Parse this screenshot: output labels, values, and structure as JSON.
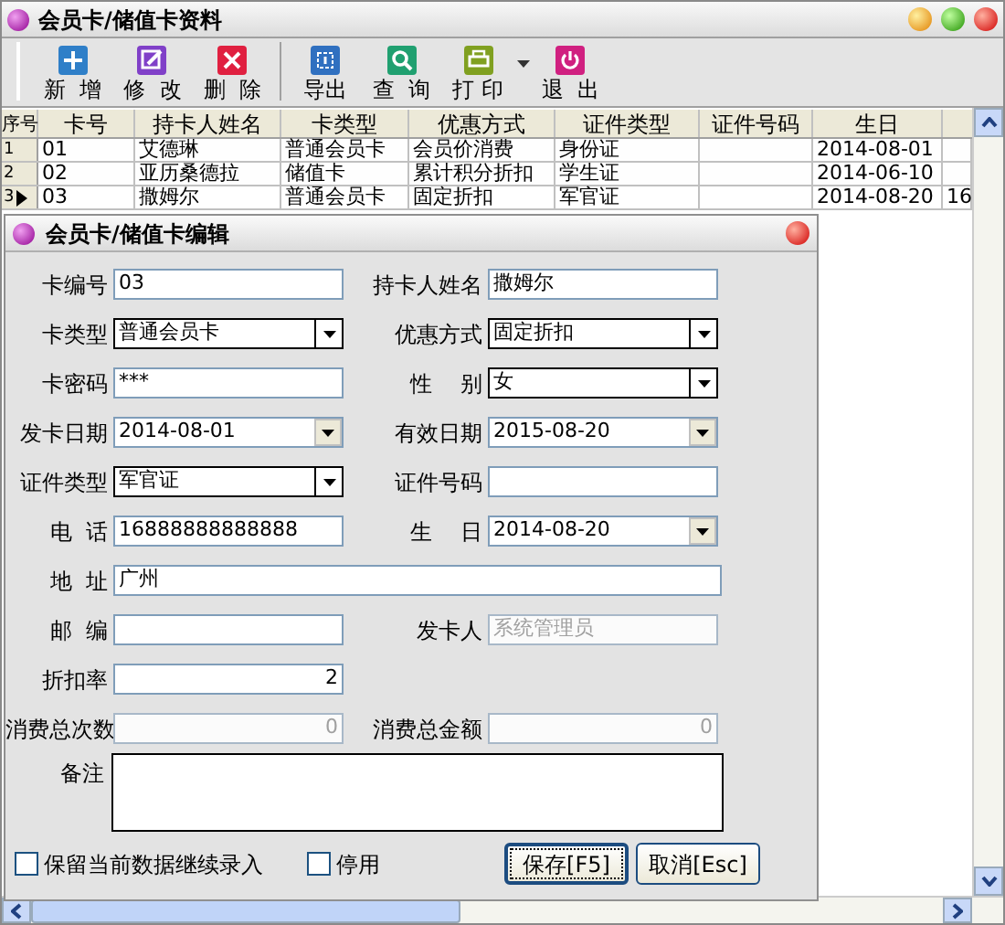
{
  "window": {
    "title": "会员卡/储值卡资料"
  },
  "toolbar": {
    "buttons": [
      {
        "kind": "add",
        "label": "新  增"
      },
      {
        "kind": "edit",
        "label": "修  改"
      },
      {
        "kind": "delete",
        "label": "删  除"
      },
      {
        "kind": "separator"
      },
      {
        "kind": "export",
        "label": "导出"
      },
      {
        "kind": "search",
        "label": "查  询"
      },
      {
        "kind": "print",
        "label": "打 印"
      },
      {
        "kind": "menu"
      },
      {
        "kind": "exit",
        "label": "退  出"
      }
    ]
  },
  "grid": {
    "columns": [
      "序号",
      "卡号",
      "持卡人姓名",
      "卡类型",
      "优惠方式",
      "证件类型",
      "证件号码",
      "生日"
    ],
    "rows": [
      {
        "current": false,
        "cells": [
          "1",
          "01",
          "艾德琳",
          "普通会员卡",
          "会员价消费",
          "身份证",
          "",
          "2014-08-01",
          ""
        ]
      },
      {
        "current": false,
        "cells": [
          "2",
          "02",
          "亚历桑德拉",
          "储值卡",
          "累计积分折扣",
          "学生证",
          "",
          "2014-06-10",
          ""
        ]
      },
      {
        "current": true,
        "cells": [
          "3",
          "03",
          "撒姆尔",
          "普通会员卡",
          "固定折扣",
          "军官证",
          "",
          "2014-08-20",
          "16"
        ]
      }
    ]
  },
  "dialog": {
    "title": "会员卡/储值卡编辑",
    "rows": [
      [
        {
          "label": "卡编号",
          "kind": "text",
          "value": "03",
          "disabled": false
        },
        {
          "label": "持卡人姓名",
          "kind": "text",
          "value": "撒姆尔",
          "disabled": false
        }
      ],
      [
        {
          "label": "卡类型",
          "kind": "select",
          "value": "普通会员卡",
          "disabled": false
        },
        {
          "label": "优惠方式",
          "kind": "select",
          "value": "固定折扣",
          "disabled": false
        }
      ],
      [
        {
          "label": "卡密码",
          "kind": "text",
          "value": "***",
          "disabled": false
        },
        {
          "label": "性    别",
          "kind": "select",
          "value": "女",
          "disabled": false
        }
      ],
      [
        {
          "label": "发卡日期",
          "kind": "date",
          "value": "2014-08-01",
          "disabled": false
        },
        {
          "label": "有效日期",
          "kind": "date",
          "value": "2015-08-20",
          "disabled": false
        }
      ],
      [
        {
          "label": "证件类型",
          "kind": "select",
          "value": "军官证",
          "disabled": false
        },
        {
          "label": "证件号码",
          "kind": "text",
          "disabled": false
        }
      ],
      [
        {
          "label": "电  话",
          "kind": "text",
          "value": "16888888888888",
          "disabled": false
        },
        {
          "label": "生    日",
          "kind": "date",
          "value": "2014-08-20",
          "disabled": false
        }
      ],
      [
        {
          "label": "地  址",
          "kind": "wide",
          "value": "广州",
          "disabled": false
        }
      ],
      [
        {
          "label": "邮  编",
          "kind": "text",
          "disabled": false
        },
        {
          "label": "发卡人",
          "kind": "text",
          "value": "系统管理员",
          "disabled": true
        }
      ],
      [
        {
          "label": "折扣率",
          "kind": "number",
          "value": "2",
          "disabled": false
        }
      ],
      [
        {
          "label": "消费总次数",
          "kind": "number",
          "value": "0",
          "disabled": true
        },
        {
          "label": "消费总金额",
          "kind": "number",
          "value": "0",
          "disabled": true
        }
      ]
    ],
    "remark": {
      "label": "备注"
    },
    "checkboxes": [
      {
        "label": "保留当前数据继续录入",
        "checked": false
      },
      {
        "label": "停用",
        "checked": false
      }
    ],
    "buttons": [
      {
        "label": "保存[F5]",
        "default": true
      },
      {
        "label": "取消[Esc]",
        "default": false
      }
    ]
  }
}
